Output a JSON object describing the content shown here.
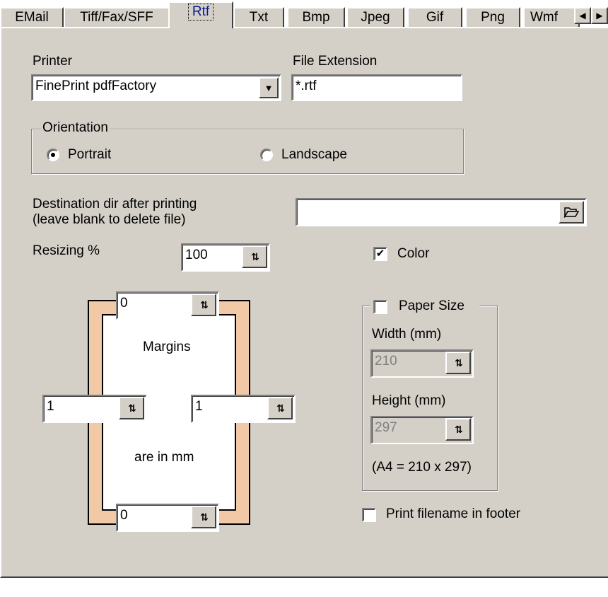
{
  "tabs": [
    "EMail",
    "Tiff/Fax/SFF",
    "Rtf",
    "Txt",
    "Bmp",
    "Jpeg",
    "Gif",
    "Png",
    "Wmf"
  ],
  "active_tab": "Rtf",
  "tab_scroll": {
    "left_icon": "arrow-left-icon",
    "right_icon": "arrow-right-icon",
    "left_glyph": "◀",
    "right_glyph": "▶"
  },
  "printer": {
    "label": "Printer",
    "value": "FinePrint pdfFactory",
    "dropdown_glyph": "▼"
  },
  "file_extension": {
    "label": "File Extension",
    "value": "*.rtf"
  },
  "orientation": {
    "legend": "Orientation",
    "portrait_label": "Portrait",
    "landscape_label": "Landscape",
    "selected": "Portrait"
  },
  "destination": {
    "label_line1": "Destination dir after printing",
    "label_line2": "(leave blank to delete file)",
    "value": "",
    "browse_icon": "folder-open-icon",
    "browse_glyph": "🗁"
  },
  "resizing": {
    "label": "Resizing %",
    "value": "100"
  },
  "spin_glyph": "⇅",
  "color": {
    "label": "Color",
    "checked": true,
    "check_glyph": "✔"
  },
  "margins": {
    "top": "0",
    "left": "1",
    "right": "1",
    "bottom": "0",
    "caption1": "Margins",
    "caption2": "are in mm"
  },
  "paper_size": {
    "label": "Paper Size",
    "checked": false,
    "width_label": "Width (mm)",
    "width_value": "210",
    "height_label": "Height (mm)",
    "height_value": "297",
    "note": "(A4 = 210 x 297)"
  },
  "footer_filename": {
    "label": "Print filename in footer",
    "checked": false
  },
  "colors": {
    "panel": "#d4d0c8",
    "page_border": "#f2c9a6",
    "active_tab_text": "#0a1a8a"
  }
}
